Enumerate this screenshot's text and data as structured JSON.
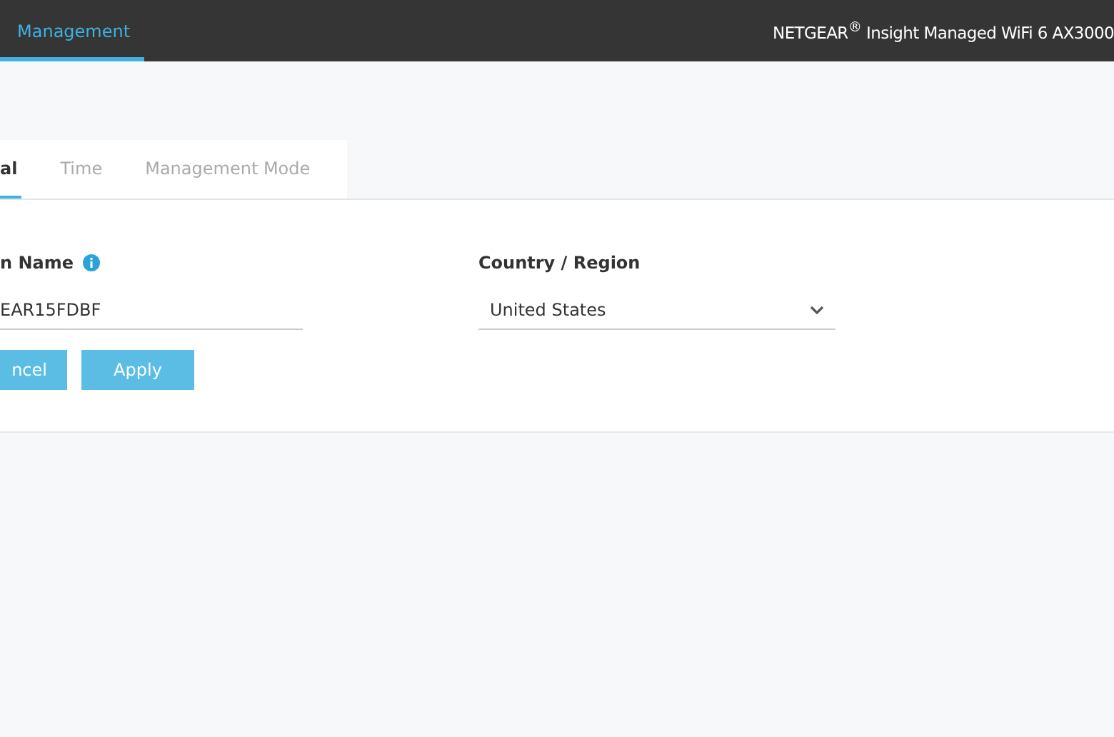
{
  "top_bar": {
    "tabs": [
      {
        "label": "Management",
        "selected": true
      }
    ],
    "product_title": "NETGEAR$^{®}$ Insight Managed WiFi 6 AX3000"
  },
  "tabs": [
    {
      "label": "al",
      "selected": true
    },
    {
      "label": "Time",
      "selected": false
    },
    {
      "label": "Management Mode",
      "selected": false
    }
  ],
  "form": {
    "name_label": "n Name",
    "name_value": "EAR15FDBF",
    "country_label": "Country / Region",
    "country_value": "United States"
  },
  "buttons": [
    {
      "label": "ncel"
    },
    {
      "label": "Apply"
    }
  ]
}
